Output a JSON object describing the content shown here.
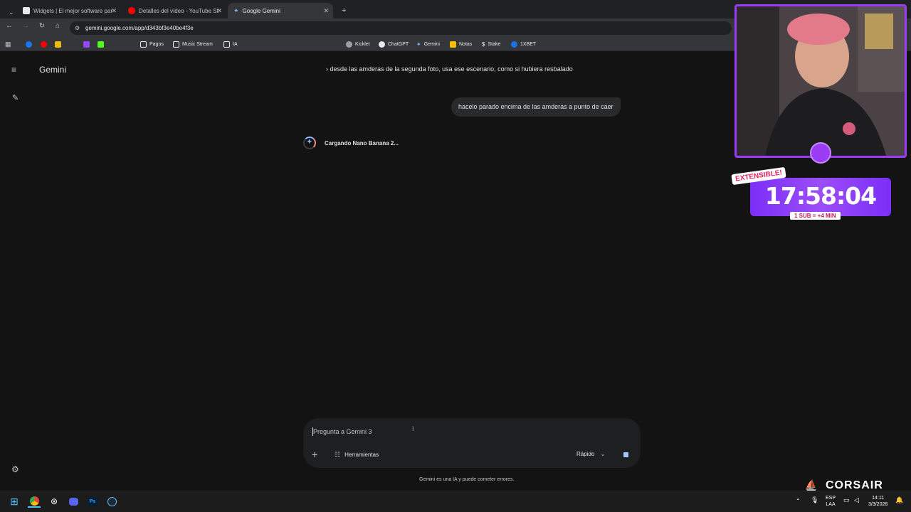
{
  "browser": {
    "tabs": [
      {
        "title": "Widgets | El mejor software par",
        "active": false
      },
      {
        "title": "Detalles del vídeo - YouTube St",
        "active": false
      },
      {
        "title": "Google Gemini",
        "active": true
      }
    ],
    "url": "gemini.google.com/app/d343bf3e40be4f3e",
    "bookmarks": [
      "Pagos",
      "Music Stream",
      "IA",
      "Kicklet",
      "ChatGPT",
      "Gemini",
      "Notas",
      "Stake",
      "1XBET"
    ]
  },
  "gemini": {
    "title": "Gemini",
    "prev_message": "› desde las amderas de la segunda foto, usa ese escenario, como si hubiera resbalado",
    "user_message": "hacelo parado encima de las amderas a punto de caer",
    "loading_text": "Cargando Nano Banana 2...",
    "input_placeholder": "Pregunta a Gemini 3",
    "tools_label": "Herramientas",
    "mode_label": "Rápido",
    "disclaimer": "Gemini es una IA y puede cometer errores."
  },
  "overlay": {
    "extensible_label": "EXTENSIBLE!",
    "timer": "17:58:04",
    "sub_label": "1 SUB = +4 MIN",
    "brand": "CORSAIR"
  },
  "taskbar": {
    "lang": "ESP",
    "lang2": "LAA",
    "time": "14:11",
    "date": "3/3/2026"
  },
  "colors": {
    "background": "#131314",
    "accent": "#9b3cf5",
    "bubble": "#282a2c"
  }
}
